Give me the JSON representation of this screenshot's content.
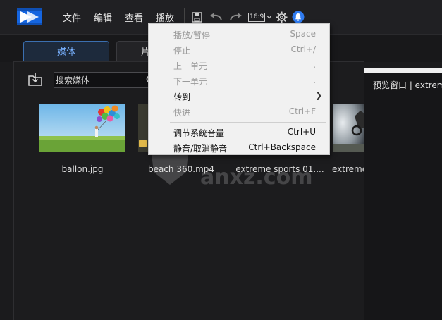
{
  "menubar": {
    "items": [
      "文件",
      "编辑",
      "查看",
      "播放"
    ],
    "aspect_ratio": "16:9",
    "accent_color": "#2f7bf0"
  },
  "tabs": {
    "media": "媒体",
    "second": "片"
  },
  "library": {
    "search_placeholder": "搜索媒体",
    "items": [
      {
        "name": "ballon.jpg"
      },
      {
        "name": "beach 360.mp4"
      },
      {
        "name": "extreme sports 01...."
      },
      {
        "name": "extreme"
      }
    ]
  },
  "preview": {
    "title": "预览窗口 | extreme"
  },
  "playback_menu": {
    "items": [
      {
        "label": "播放/暂停",
        "shortcut": "Space",
        "enabled": false
      },
      {
        "label": "停止",
        "shortcut": "Ctrl+/",
        "enabled": false
      },
      {
        "label": "上一单元",
        "shortcut": ",",
        "enabled": false
      },
      {
        "label": "下一单元",
        "shortcut": ".",
        "enabled": false
      },
      {
        "label": "转到",
        "shortcut": "",
        "enabled": true,
        "submenu": true
      },
      {
        "label": "快进",
        "shortcut": "Ctrl+F",
        "enabled": false
      },
      {
        "label": "调节系统音量",
        "shortcut": "Ctrl+U",
        "enabled": true
      },
      {
        "label": "静音/取消静音",
        "shortcut": "Ctrl+Backspace",
        "enabled": true
      }
    ]
  },
  "watermark": {
    "text": "anxz.com"
  }
}
